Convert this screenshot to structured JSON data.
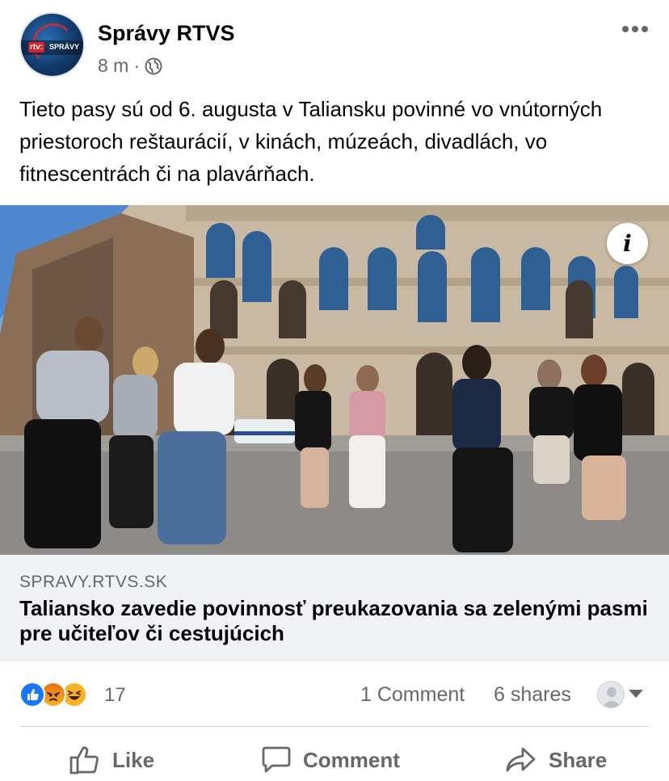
{
  "post": {
    "page_name": "Správy RTVS",
    "time": "8 m",
    "separator": "·",
    "privacy_icon": "globe-icon",
    "more_icon": "more-horizontal-icon",
    "avatar_logo_rtv": "rtv:",
    "avatar_logo_text": "SPRÁVY",
    "text": "Tieto pasy sú od 6. augusta v Taliansku povinné vo vnútorných priestoroch reštaurácií, v kinách, múzeách, divadlách, vo fitnescentrách či na plavárňach."
  },
  "link": {
    "info_icon": "info-icon",
    "info_label": "i",
    "domain": "SPRAVY.RTVS.SK",
    "title": "Taliansko zavedie povinnosť preukazovania sa zelenými pasmi pre učiteľov či cestujúcich"
  },
  "stats": {
    "reaction_icons": [
      "like-reaction-icon",
      "angry-reaction-icon",
      "haha-reaction-icon"
    ],
    "reaction_count": "17",
    "comments": "1 Comment",
    "shares": "6 shares"
  },
  "actions": {
    "like": "Like",
    "comment": "Comment",
    "share": "Share"
  },
  "colors": {
    "text_primary": "#050505",
    "text_secondary": "#65676b",
    "link_bg": "#f0f2f5",
    "like_blue": "#1877f2",
    "reaction_yellow": "#f7b125",
    "divider": "#ced0d4"
  }
}
